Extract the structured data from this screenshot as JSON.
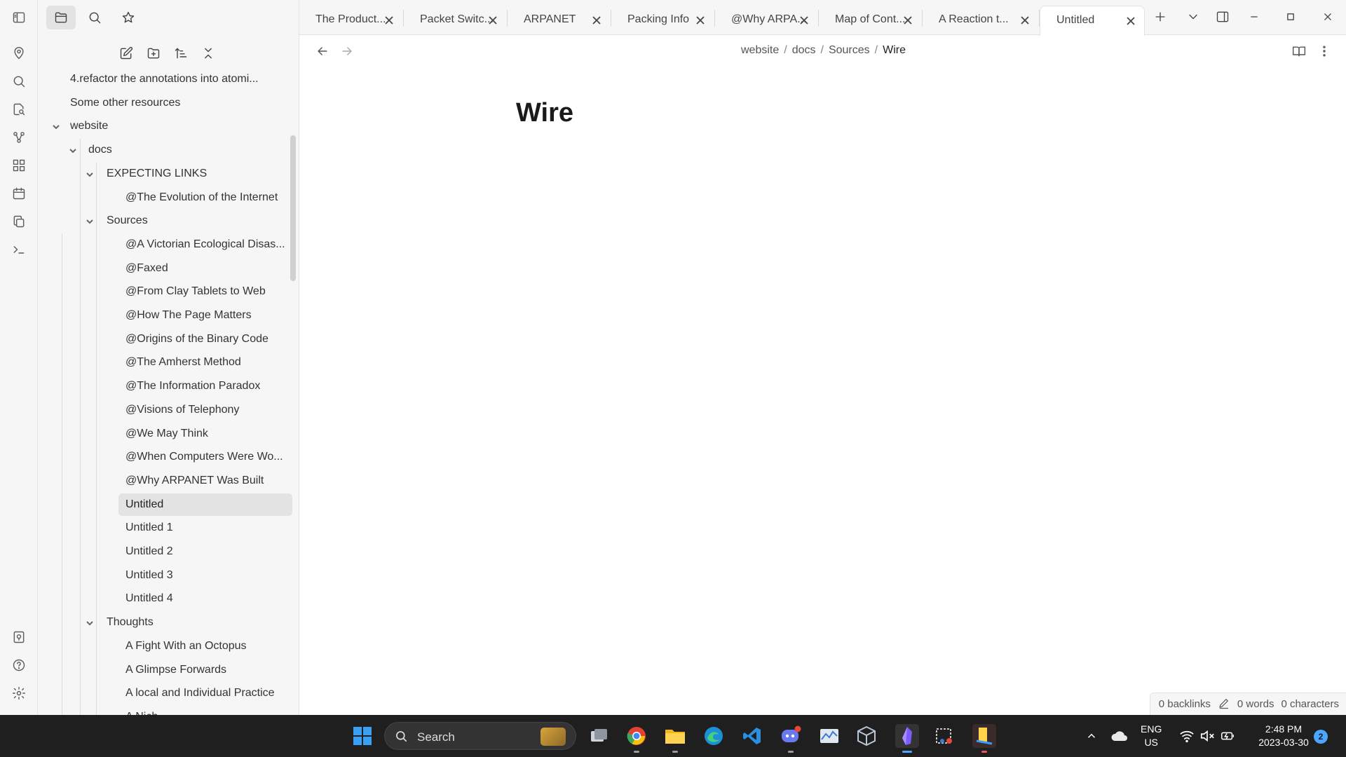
{
  "ribbon": {
    "icons": [
      "map-pin-icon",
      "search-icon",
      "file-search-icon",
      "graph-icon",
      "dashboard-icon",
      "calendar-icon",
      "copy-icon",
      "terminal-icon",
      "vault-icon",
      "help-icon",
      "settings-icon"
    ]
  },
  "sidebar": {
    "tree": [
      {
        "label": "4.refactor the annotations into atomi...",
        "level": 0,
        "folder": false
      },
      {
        "label": "Some other resources",
        "level": 0,
        "folder": false
      },
      {
        "label": "website",
        "level": 0,
        "folder": true
      },
      {
        "label": "docs",
        "level": 1,
        "folder": true
      },
      {
        "label": "EXPECTING LINKS",
        "level": 2,
        "folder": true
      },
      {
        "label": "@The Evolution of the Internet",
        "level": 3,
        "folder": false
      },
      {
        "label": "Sources",
        "level": 2,
        "folder": true
      },
      {
        "label": "@A Victorian Ecological Disas...",
        "level": 3,
        "folder": false
      },
      {
        "label": "@Faxed",
        "level": 3,
        "folder": false
      },
      {
        "label": "@From Clay Tablets to Web",
        "level": 3,
        "folder": false
      },
      {
        "label": "@How The Page Matters",
        "level": 3,
        "folder": false
      },
      {
        "label": "@Origins of the Binary Code",
        "level": 3,
        "folder": false
      },
      {
        "label": "@The Amherst Method",
        "level": 3,
        "folder": false
      },
      {
        "label": "@The Information Paradox",
        "level": 3,
        "folder": false
      },
      {
        "label": "@Visions of Telephony",
        "level": 3,
        "folder": false
      },
      {
        "label": "@We May Think",
        "level": 3,
        "folder": false
      },
      {
        "label": "@When Computers Were Wo...",
        "level": 3,
        "folder": false
      },
      {
        "label": "@Why ARPANET Was Built",
        "level": 3,
        "folder": false
      },
      {
        "label": "Untitled",
        "level": 3,
        "folder": false,
        "selected": true
      },
      {
        "label": "Untitled 1",
        "level": 3,
        "folder": false
      },
      {
        "label": "Untitled 2",
        "level": 3,
        "folder": false
      },
      {
        "label": "Untitled 3",
        "level": 3,
        "folder": false
      },
      {
        "label": "Untitled 4",
        "level": 3,
        "folder": false
      },
      {
        "label": "Thoughts",
        "level": 2,
        "folder": true
      },
      {
        "label": "A Fight With an Octopus",
        "level": 3,
        "folder": false
      },
      {
        "label": "A Glimpse Forwards",
        "level": 3,
        "folder": false
      },
      {
        "label": "A local and Individual Practice",
        "level": 3,
        "folder": false
      },
      {
        "label": "A Nich...",
        "level": 3,
        "folder": false
      }
    ]
  },
  "tabs": [
    {
      "label": "The Product..."
    },
    {
      "label": "Packet Switc..."
    },
    {
      "label": "ARPANET"
    },
    {
      "label": "Packing Info"
    },
    {
      "label": "@Why ARPA..."
    },
    {
      "label": "Map of Cont..."
    },
    {
      "label": "A Reaction t..."
    },
    {
      "label": "Untitled",
      "active": true
    }
  ],
  "breadcrumb": [
    "website",
    "docs",
    "Sources",
    "Wire"
  ],
  "document": {
    "title": "Wire"
  },
  "status": {
    "backlinks": "0 backlinks",
    "words": "0 words",
    "characters": "0 characters"
  },
  "taskbar": {
    "search_label": "Search",
    "apps": [
      "windows-start-icon",
      "task-view-icon",
      "chrome-icon",
      "file-explorer-icon",
      "edge-icon",
      "vscode-icon",
      "discord-icon",
      "stock-app-icon",
      "box-app-icon",
      "obsidian-icon",
      "snipping-tool-icon",
      "sticky-app-icon"
    ],
    "lang_top": "ENG",
    "lang_bottom": "US",
    "time": "2:48 PM",
    "date": "2023-03-30",
    "notification_count": "2"
  },
  "colors": {
    "selected_bg": "#e3e3e3",
    "sidebar_bg": "#f6f6f6",
    "taskbar_bg": "#1f1f1f",
    "obsidian_accent": "#7c5cff"
  }
}
